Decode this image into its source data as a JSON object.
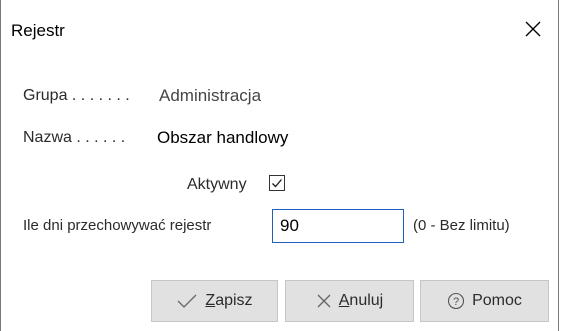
{
  "window": {
    "title": "Rejestr"
  },
  "form": {
    "group_label": "Grupa . . . . . . .",
    "group_value": "Administracja",
    "name_label": "Nazwa . . . . . .",
    "name_value": "Obszar handlowy",
    "active_label": "Aktywny",
    "active_checked": true,
    "retention_label": "Ile dni przechowywać rejestr",
    "retention_value": "90",
    "retention_hint": "(0 - Bez limitu)"
  },
  "buttons": {
    "save_accel": "Z",
    "save_rest": "apisz",
    "cancel_accel": "A",
    "cancel_rest": "nuluj",
    "help_label": "Pomoc"
  }
}
